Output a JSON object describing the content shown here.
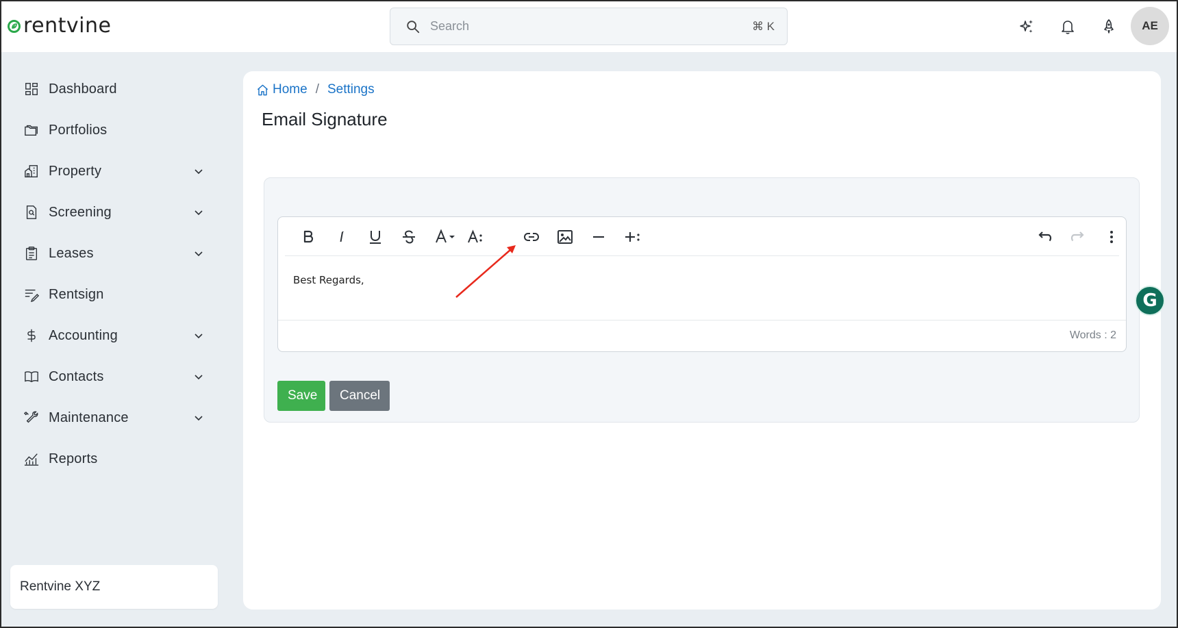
{
  "header": {
    "brand": "rentvine",
    "search_placeholder": "Search",
    "search_shortcut": "⌘ K",
    "avatar_initials": "AE",
    "icons": [
      "sparkle-icon",
      "bell-icon",
      "rocket-icon"
    ]
  },
  "sidebar": {
    "items": [
      {
        "label": "Dashboard",
        "icon": "dashboard-icon",
        "expandable": false
      },
      {
        "label": "Portfolios",
        "icon": "folder-icon",
        "expandable": false
      },
      {
        "label": "Property",
        "icon": "building-icon",
        "expandable": true
      },
      {
        "label": "Screening",
        "icon": "screening-icon",
        "expandable": true
      },
      {
        "label": "Leases",
        "icon": "clipboard-icon",
        "expandable": true
      },
      {
        "label": "Rentsign",
        "icon": "sign-icon",
        "expandable": false
      },
      {
        "label": "Accounting",
        "icon": "dollar-icon",
        "expandable": true
      },
      {
        "label": "Contacts",
        "icon": "book-icon",
        "expandable": true
      },
      {
        "label": "Maintenance",
        "icon": "wrench-icon",
        "expandable": true
      },
      {
        "label": "Reports",
        "icon": "chart-icon",
        "expandable": false
      }
    ],
    "org_name": "Rentvine XYZ"
  },
  "breadcrumb": {
    "home": "Home",
    "separator": "/",
    "current": "Settings"
  },
  "page": {
    "title": "Email Signature"
  },
  "editor": {
    "content": "Best Regards,",
    "word_count": "Words : 2",
    "toolbar": [
      "bold",
      "italic",
      "underline",
      "strikethrough",
      "font-color",
      "font-size",
      "link",
      "image",
      "horizontal-rule",
      "insert-more",
      "undo",
      "redo",
      "more"
    ]
  },
  "actions": {
    "save_label": "Save",
    "cancel_label": "Cancel"
  },
  "colors": {
    "accent_link": "#1a73c7",
    "save": "#3fb04f",
    "cancel": "#6c757d",
    "annotation_arrow": "#e8291c",
    "brand_green": "#2aa84a"
  }
}
